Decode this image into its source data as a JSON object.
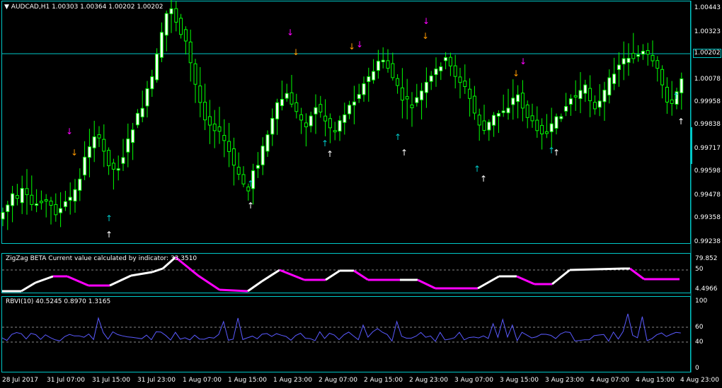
{
  "main_title": {
    "symbol": "AUDCAD,H1",
    "ohlc": "1.00303 1.00364 1.00202 1.00202"
  },
  "current_price": "1.00202",
  "price_axis": [
    "1.00443",
    "1.00323",
    "1.00202",
    "1.00078",
    "0.99958",
    "0.99838",
    "0.99717",
    "0.99598",
    "0.99478",
    "0.99358",
    "0.99238"
  ],
  "zigzag": {
    "title": "ZigZag BETA Current value calculated by indicator: 33.3510",
    "axis": [
      "79.852",
      "50",
      "4.4966"
    ]
  },
  "rbvi": {
    "title": "RBVI(10) 40.5245 0.8970 1.3165",
    "axis": [
      "100",
      "60",
      "40",
      "0"
    ]
  },
  "time_axis": [
    "28 Jul 2017",
    "31 Jul 07:00",
    "31 Jul 15:00",
    "31 Jul 23:00",
    "1 Aug 07:00",
    "1 Aug 15:00",
    "1 Aug 23:00",
    "2 Aug 07:00",
    "2 Aug 15:00",
    "2 Aug 23:00",
    "3 Aug 07:00",
    "3 Aug 15:00",
    "3 Aug 23:00",
    "4 Aug 07:00",
    "4 Aug 15:00",
    "4 Aug 23:00"
  ],
  "colors": {
    "bull": "#ffffff",
    "bear": "#00ff00",
    "wick": "#00ff00",
    "grid": "#00c8c8",
    "zz_up": "#ffffff",
    "zz_down": "#ff00ff",
    "rbvi": "#5a5aff",
    "arrow_down_magenta": "#ff00ff",
    "arrow_down_orange": "#ff9900",
    "arrow_up_white": "#ffffff",
    "arrow_up_cyan": "#00c8c8"
  }
}
